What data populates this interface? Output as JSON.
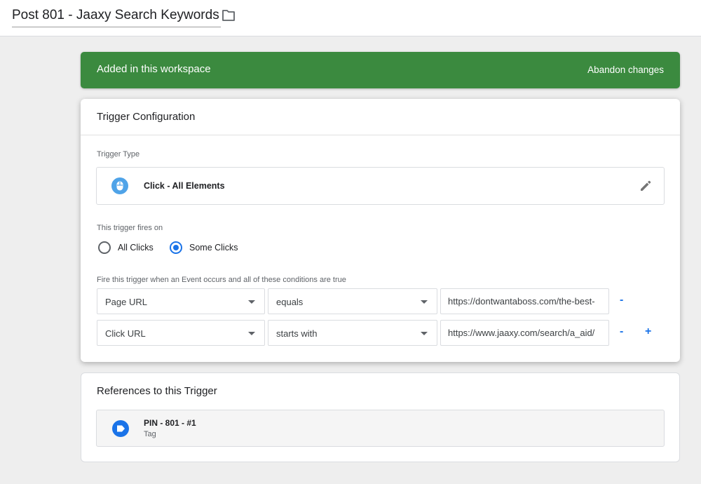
{
  "header": {
    "title": "Post 801 - Jaaxy Search Keywords",
    "folder_icon": "folder-icon"
  },
  "banner": {
    "text": "Added in this workspace",
    "action": "Abandon changes",
    "color": "#3b8a3f"
  },
  "config": {
    "title": "Trigger Configuration",
    "trigger_type_label": "Trigger Type",
    "trigger_type": {
      "icon": "mouse-icon",
      "name": "Click - All Elements",
      "edit_icon": "pencil-icon"
    },
    "fires_on_label": "This trigger fires on",
    "fires_on_options": [
      {
        "label": "All Clicks",
        "selected": false
      },
      {
        "label": "Some Clicks",
        "selected": true
      }
    ],
    "conditions_label": "Fire this trigger when an Event occurs and all of these conditions are true",
    "conditions": [
      {
        "variable": "Page URL",
        "operator": "equals",
        "value": "https://dontwantaboss.com/the-best-",
        "remove": "-"
      },
      {
        "variable": "Click URL",
        "operator": "starts with",
        "value": "https://www.jaaxy.com/search/a_aid/",
        "remove": "-",
        "add": "+"
      }
    ]
  },
  "references": {
    "title": "References to this Trigger",
    "items": [
      {
        "icon": "tag-icon",
        "name": "PIN - 801 - #1",
        "type": "Tag"
      }
    ]
  },
  "colors": {
    "accent": "#1a73e8",
    "success": "#3b8a3f"
  }
}
